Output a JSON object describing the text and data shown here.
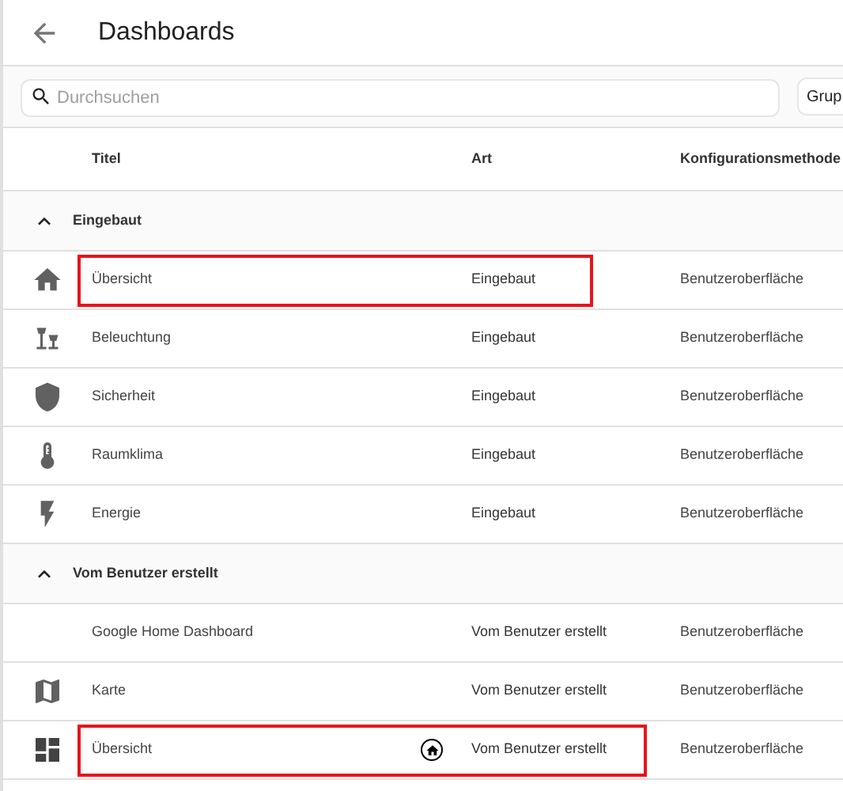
{
  "header": {
    "title": "Dashboards"
  },
  "toolbar": {
    "search": {
      "placeholder": "Durchsuchen"
    },
    "group_button": "Grup"
  },
  "table": {
    "columns": [
      "Titel",
      "Art",
      "Konfigurationsmethode"
    ],
    "groups": [
      {
        "label": "Eingebaut",
        "expanded": true,
        "rows": [
          {
            "title": "Übersicht",
            "type": "Eingebaut",
            "method": "Benutzeroberfläche",
            "highlighted": true,
            "default": false
          },
          {
            "title": "Beleuchtung",
            "type": "Eingebaut",
            "method": "Benutzeroberfläche",
            "highlighted": false,
            "default": false
          },
          {
            "title": "Sicherheit",
            "type": "Eingebaut",
            "method": "Benutzeroberfläche",
            "highlighted": false,
            "default": false
          },
          {
            "title": "Raumklima",
            "type": "Eingebaut",
            "method": "Benutzeroberfläche",
            "highlighted": false,
            "default": false
          },
          {
            "title": "Energie",
            "type": "Eingebaut",
            "method": "Benutzeroberfläche",
            "highlighted": false,
            "default": false
          }
        ]
      },
      {
        "label": "Vom Benutzer erstellt",
        "expanded": true,
        "rows": [
          {
            "title": "Google Home Dashboard",
            "type": "Vom Benutzer erstellt",
            "method": "Benutzeroberfläche",
            "highlighted": false,
            "default": false
          },
          {
            "title": "Karte",
            "type": "Vom Benutzer erstellt",
            "method": "Benutzeroberfläche",
            "highlighted": false,
            "default": false
          },
          {
            "title": "Übersicht",
            "type": "Vom Benutzer erstellt",
            "method": "Benutzeroberfläche",
            "highlighted": true,
            "default": true
          }
        ]
      }
    ]
  }
}
